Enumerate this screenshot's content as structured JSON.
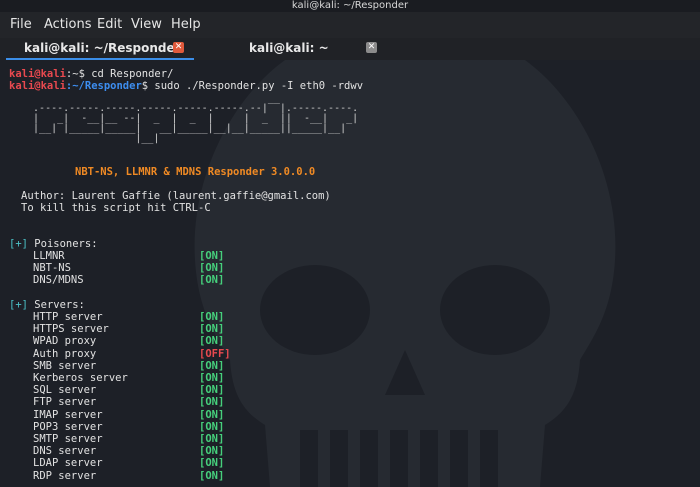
{
  "window": {
    "title": "kali@kali: ~/Responder"
  },
  "menu": {
    "file": "File",
    "actions": "Actions",
    "edit": "Edit",
    "view": "View",
    "help": "Help"
  },
  "tabs": [
    {
      "label": "kali@kali: ~/Responder",
      "close": "x"
    },
    {
      "label": "kali@kali: ~",
      "close": "x"
    }
  ],
  "terminal": {
    "line1": {
      "user": "kali@kali",
      "path": ":~",
      "cmd": "$ cd Responder/"
    },
    "line2": {
      "user": "kali@kali",
      "path": ":~/Responder",
      "cmd": "$ sudo ./Responder.py -I eth0 -rdwv"
    },
    "banner": "                                         __\n  .----.-----.-----.-----.-----.-----.--|  |.-----.----.\n  |   _|  -__|__ --|  _  |  _  |     |  _  ||  -__|   _|\n  |__| |_____|_____|   __|_____|__|__|_____||_____|__|\n                   |__|",
    "subtitle": "NBT-NS, LLMNR & MDNS Responder 3.0.0.0",
    "author": "Author: Laurent Gaffie (laurent.gaffie@gmail.com)",
    "kill": "To kill this script hit CTRL-C",
    "poisoners": {
      "heading": "Poisoners:",
      "marker": "[+]",
      "items": [
        {
          "name": "LLMNR",
          "status": "[ON]"
        },
        {
          "name": "NBT-NS",
          "status": "[ON]"
        },
        {
          "name": "DNS/MDNS",
          "status": "[ON]"
        }
      ]
    },
    "servers": {
      "heading": "Servers:",
      "marker": "[+]",
      "items": [
        {
          "name": "HTTP server",
          "status": "[ON]"
        },
        {
          "name": "HTTPS server",
          "status": "[ON]"
        },
        {
          "name": "WPAD proxy",
          "status": "[ON]"
        },
        {
          "name": "Auth proxy",
          "status": "[OFF]"
        },
        {
          "name": "SMB server",
          "status": "[ON]"
        },
        {
          "name": "Kerberos server",
          "status": "[ON]"
        },
        {
          "name": "SQL server",
          "status": "[ON]"
        },
        {
          "name": "FTP server",
          "status": "[ON]"
        },
        {
          "name": "IMAP server",
          "status": "[ON]"
        },
        {
          "name": "POP3 server",
          "status": "[ON]"
        },
        {
          "name": "SMTP server",
          "status": "[ON]"
        },
        {
          "name": "DNS server",
          "status": "[ON]"
        },
        {
          "name": "LDAP server",
          "status": "[ON]"
        },
        {
          "name": "RDP server",
          "status": "[ON]"
        }
      ]
    }
  },
  "colors": {
    "on": "#46d07c",
    "off": "#e8494f",
    "user": "#e8494f",
    "path": "#3d8ef0",
    "subtitle": "#f08a24",
    "marker": "#4cc3c8"
  }
}
